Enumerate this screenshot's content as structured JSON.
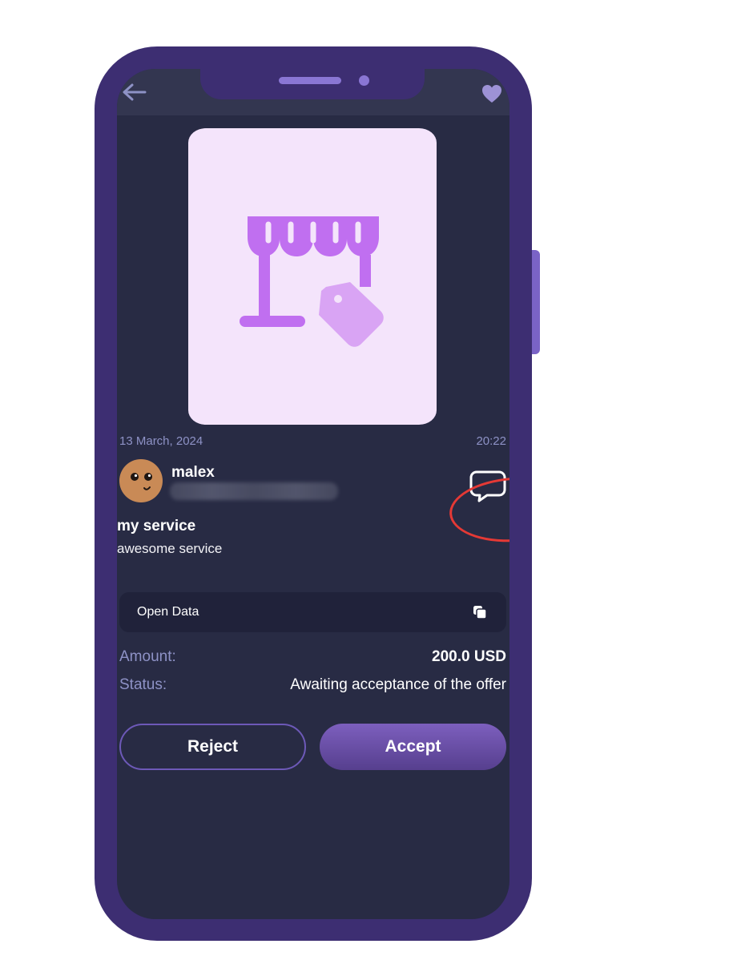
{
  "colors": {
    "frame": "#3d2e72",
    "screen_bg": "#282b44",
    "header_bg": "#333650",
    "accent": "#6d59b8",
    "muted_text": "#8e92c6",
    "image_bg": "#f4e4fb",
    "store_icon": "#c06ff0",
    "tag_icon": "#d9a4f4",
    "highlight": "#e53935"
  },
  "header": {
    "back_icon": "arrow-left-icon",
    "favorite_icon": "heart-icon"
  },
  "service_image": {
    "icon": "storefront-tag-icon"
  },
  "meta": {
    "date": "13 March, 2024",
    "time": "20:22"
  },
  "user": {
    "name": "malex",
    "avatar_icon": "smiley-face-avatar",
    "chat_icon": "chat-bubble-icon"
  },
  "service": {
    "title": "my service",
    "description": "awesome service"
  },
  "open_data": {
    "label": "Open Data",
    "icon": "copy-icon"
  },
  "details": {
    "amount_label": "Amount:",
    "amount_value": "200.0 USD",
    "status_label": "Status:",
    "status_value": "Awaiting acceptance of the offer"
  },
  "actions": {
    "reject_label": "Reject",
    "accept_label": "Accept"
  }
}
